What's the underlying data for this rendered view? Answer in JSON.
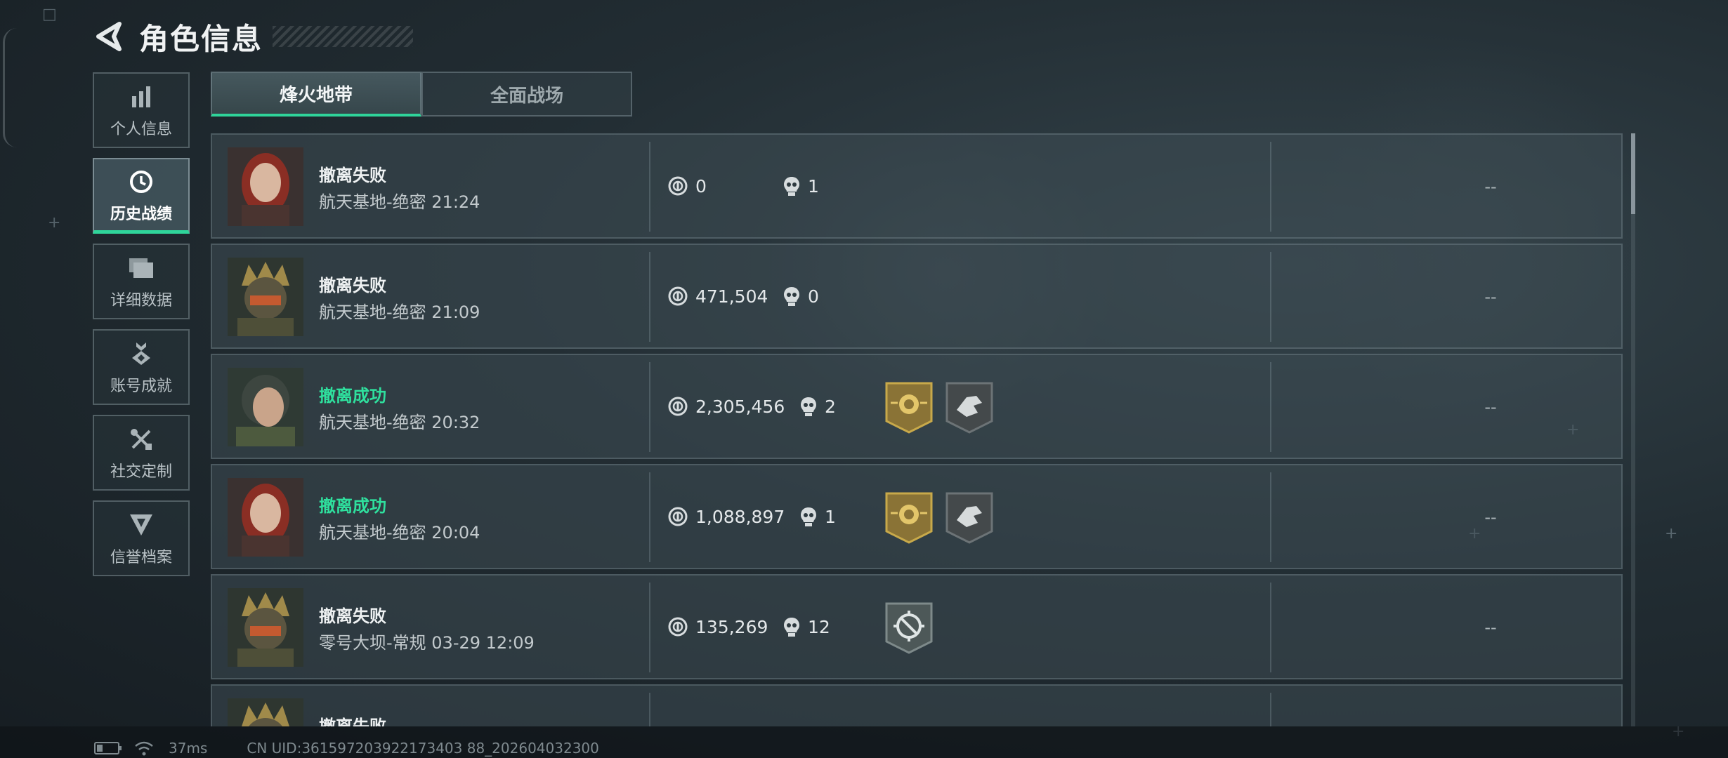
{
  "header": {
    "title": "角色信息"
  },
  "sidebar": {
    "items": [
      {
        "label": "个人信息",
        "icon": "bar-chart-icon"
      },
      {
        "label": "历史战绩",
        "icon": "history-clock-icon",
        "active": true
      },
      {
        "label": "详细数据",
        "icon": "folders-icon"
      },
      {
        "label": "账号成就",
        "icon": "achievement-medal-icon"
      },
      {
        "label": "社交定制",
        "icon": "tools-icon"
      },
      {
        "label": "信誉档案",
        "icon": "credit-shield-icon"
      }
    ]
  },
  "tabs": [
    {
      "label": "烽火地带",
      "active": true
    },
    {
      "label": "全面战场",
      "active": false
    }
  ],
  "records": [
    {
      "result": "撤离失败",
      "success": false,
      "map": "航天基地-绝密 21:24",
      "coins": "0",
      "kills": "1",
      "badges": [],
      "extra": "--"
    },
    {
      "result": "撤离失败",
      "success": false,
      "map": "航天基地-绝密 21:09",
      "coins": "471,504",
      "kills": "0",
      "badges": [],
      "extra": "--"
    },
    {
      "result": "撤离成功",
      "success": true,
      "map": "航天基地-绝密 20:32",
      "coins": "2,305,456",
      "kills": "2",
      "badges": [
        "gold-emblem-badge",
        "gray-hand-badge"
      ],
      "extra": "--"
    },
    {
      "result": "撤离成功",
      "success": true,
      "map": "航天基地-绝密 20:04",
      "coins": "1,088,897",
      "kills": "1",
      "badges": [
        "gold-emblem-badge",
        "gray-hand-badge"
      ],
      "extra": "--"
    },
    {
      "result": "撤离失败",
      "success": false,
      "map": "零号大坝-常规 03-29 12:09",
      "coins": "135,269",
      "kills": "12",
      "badges": [
        "crosshair-badge"
      ],
      "extra": "--"
    },
    {
      "result": "撤离失败",
      "success": false,
      "map": "",
      "coins": "",
      "kills": "",
      "badges": [],
      "extra": ""
    }
  ],
  "footer": {
    "ping": "37ms",
    "uid": "CN UID:361597203922173403 88_202604032300"
  },
  "colors": {
    "accent": "#2fd49a",
    "success": "#2fe09e"
  }
}
